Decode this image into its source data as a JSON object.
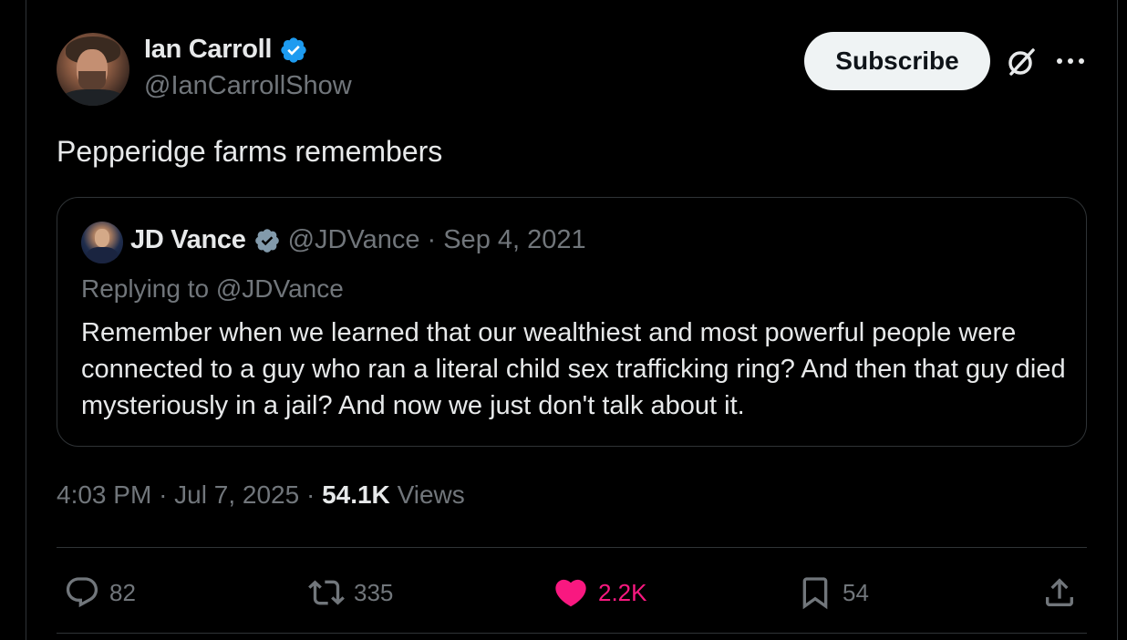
{
  "author": {
    "name": "Ian Carroll",
    "handle": "@IanCarrollShow",
    "verified_color": "#1d9bf0"
  },
  "subscribe_label": "Subscribe",
  "tweet_text": "Pepperidge farms remembers",
  "quoted": {
    "name": "JD Vance",
    "handle": "@JDVance",
    "separator": "·",
    "date": "Sep 4, 2021",
    "replying_to": "Replying to @JDVance",
    "body": "Remember when we learned that our wealthiest and most powerful people were connected to a guy who ran a literal child sex trafficking ring? And then that guy died mysteriously in a jail? And now we just don't talk about it."
  },
  "meta": {
    "time": "4:03 PM",
    "sep1": "·",
    "date": "Jul 7, 2025",
    "sep2": "·",
    "views_count": "54.1K",
    "views_label": "Views"
  },
  "actions": {
    "replies": "82",
    "reposts": "335",
    "likes": "2.2K",
    "bookmarks": "54"
  },
  "icons": {
    "reply": "reply-icon",
    "repost": "repost-icon",
    "like": "heart-icon",
    "bookmark": "bookmark-icon",
    "share": "share-icon",
    "grok": "grok-icon",
    "more": "more-icon",
    "verified": "verified-badge-icon"
  },
  "colors": {
    "background": "#000000",
    "text": "#e7e9ea",
    "secondary": "#71767b",
    "like": "#f91880",
    "verified_blue": "#1d9bf0",
    "verified_gray": "#829aab",
    "border": "#2f3336"
  }
}
